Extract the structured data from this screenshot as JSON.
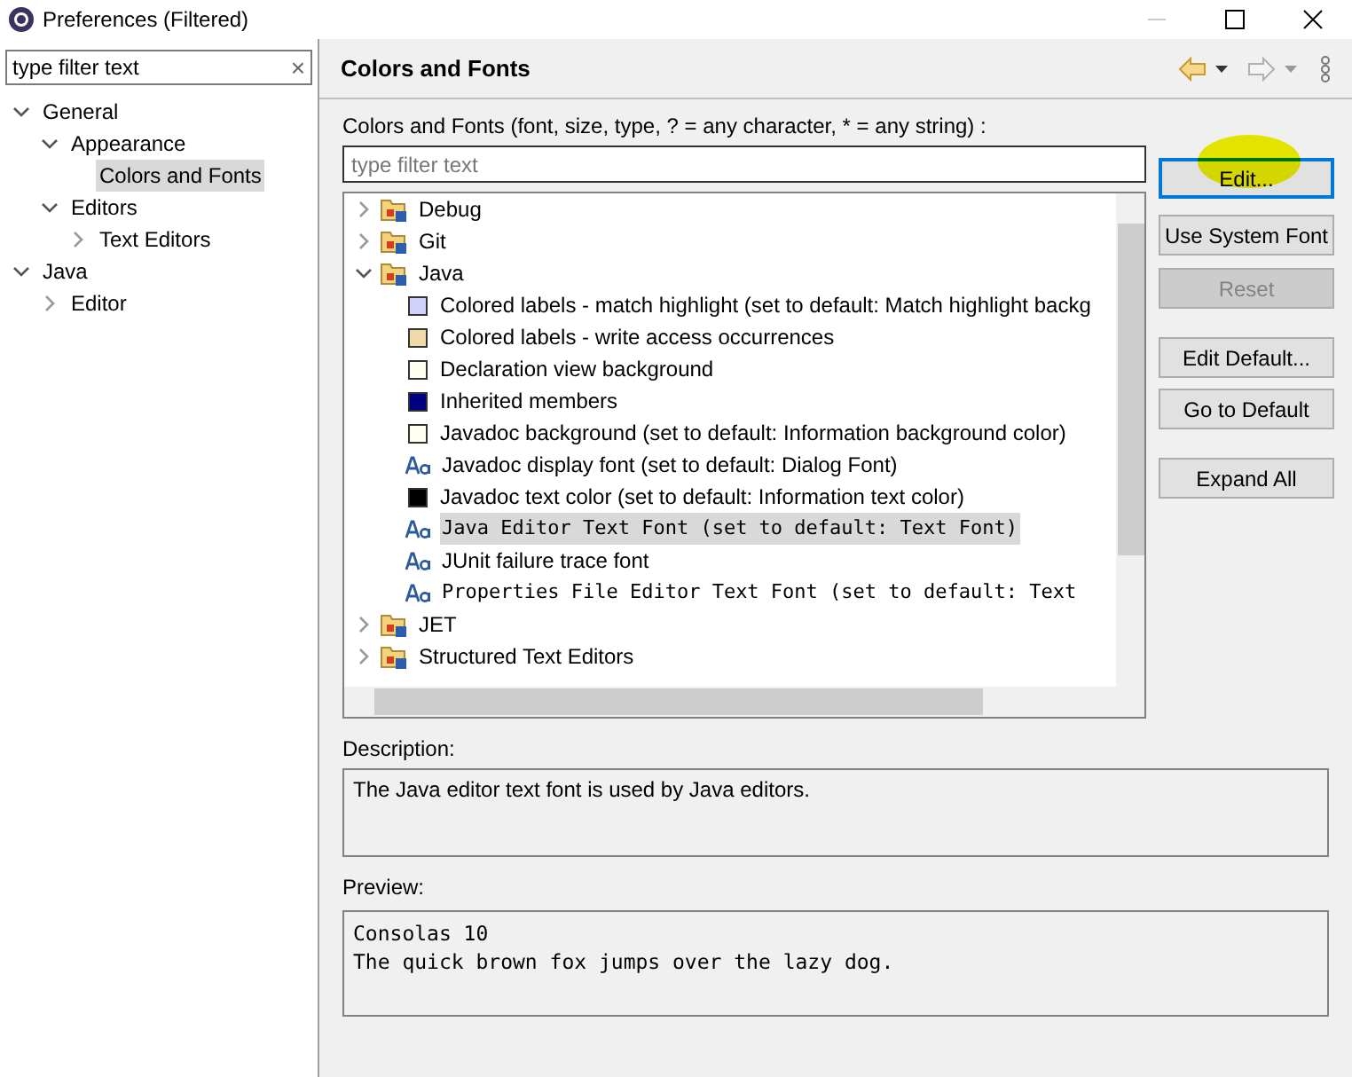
{
  "window": {
    "title": "Preferences (Filtered)"
  },
  "sidebar": {
    "filter": {
      "placeholder": "type filter text"
    },
    "clear": "×",
    "items": [
      {
        "label": "General",
        "expanded": true,
        "selected": false,
        "children": [
          {
            "label": "Appearance",
            "expanded": true,
            "selected": false,
            "children": [
              {
                "label": "Colors and Fonts",
                "selected": true
              }
            ]
          },
          {
            "label": "Editors",
            "expanded": true,
            "selected": false,
            "children": [
              {
                "label": "Text Editors",
                "expanded": false,
                "selected": false
              }
            ]
          }
        ]
      },
      {
        "label": "Java",
        "expanded": true,
        "selected": false,
        "children": [
          {
            "label": "Editor",
            "expanded": false,
            "selected": false
          }
        ]
      }
    ]
  },
  "page": {
    "title": "Colors and Fonts",
    "hint": "Colors and Fonts (font, size, type, ? = any character, * = any string) :",
    "filter": {
      "placeholder": "type filter text"
    },
    "tree": [
      {
        "label": "Debug",
        "expanded": false
      },
      {
        "label": "Git",
        "expanded": false
      },
      {
        "label": "Java",
        "expanded": true,
        "children": [
          {
            "kind": "color",
            "label": "Colored labels - match highlight (set to default: Match highlight backg",
            "color": "#d0d0f8",
            "selected": false
          },
          {
            "kind": "color",
            "label": "Colored labels - write access occurrences",
            "color": "#f0d8a8",
            "selected": false
          },
          {
            "kind": "color",
            "label": "Declaration view background",
            "color": "#fffff0",
            "selected": false
          },
          {
            "kind": "color",
            "label": "Inherited members",
            "color": "#000080",
            "selected": false
          },
          {
            "kind": "color",
            "label": "Javadoc background (set to default: Information background color)",
            "color": "#fffff0",
            "selected": false
          },
          {
            "kind": "font",
            "label": "Javadoc display font (set to default: Dialog Font)",
            "selected": false
          },
          {
            "kind": "color",
            "label": "Javadoc text color (set to default: Information text color)",
            "color": "#000000",
            "selected": false
          },
          {
            "kind": "monofont",
            "label": "Java Editor Text Font (set to default: Text Font)",
            "selected": true
          },
          {
            "kind": "font",
            "label": "JUnit failure trace font",
            "selected": false
          },
          {
            "kind": "monofont",
            "label": "Properties File Editor Text Font (set to default: Text",
            "selected": false
          }
        ]
      },
      {
        "label": "JET",
        "expanded": false
      },
      {
        "label": "Structured Text Editors",
        "expanded": false
      }
    ],
    "buttons": [
      {
        "label": "Edit...",
        "disabled": false,
        "focused": true
      },
      {
        "label": "Use System Font",
        "disabled": false,
        "focused": false
      },
      {
        "label": "Reset",
        "disabled": true,
        "focused": false
      },
      {
        "label": "Edit Default...",
        "disabled": false,
        "focused": false
      },
      {
        "label": "Go to Default",
        "disabled": false,
        "focused": false
      },
      {
        "label": "Expand All",
        "disabled": false,
        "focused": false
      }
    ],
    "description": {
      "label": "Description:",
      "text": "The Java editor text font is used by Java editors."
    },
    "preview": {
      "label": "Preview:",
      "lines": [
        "Consolas 10",
        "The quick brown fox jumps over the lazy dog."
      ]
    }
  }
}
